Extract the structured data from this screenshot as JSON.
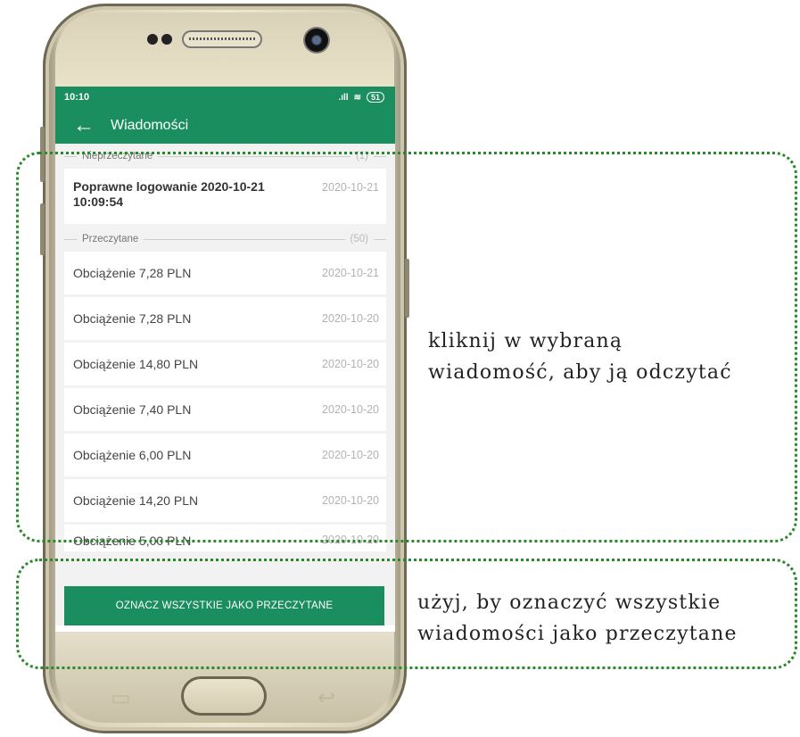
{
  "status_bar": {
    "time": "10:10",
    "signal": ".ıll",
    "wifi": "≋",
    "battery": "51"
  },
  "app_bar": {
    "back_icon": "arrow-left-icon",
    "back_glyph": "←",
    "title": "Wiadomości"
  },
  "sections": {
    "unread": {
      "label": "Nieprzeczytane",
      "count": "(1)"
    },
    "read": {
      "label": "Przeczytane",
      "count": "(50)"
    }
  },
  "unread_messages": [
    {
      "title": "Poprawne logowanie 2020-10-21 10:09:54",
      "date": "2020-10-21"
    }
  ],
  "read_messages": [
    {
      "title": "Obciążenie 7,28 PLN",
      "date": "2020-10-21"
    },
    {
      "title": "Obciążenie 7,28 PLN",
      "date": "2020-10-20"
    },
    {
      "title": "Obciążenie 14,80 PLN",
      "date": "2020-10-20"
    },
    {
      "title": "Obciążenie 7,40 PLN",
      "date": "2020-10-20"
    },
    {
      "title": "Obciążenie 6,00 PLN",
      "date": "2020-10-20"
    },
    {
      "title": "Obciążenie 14,20 PLN",
      "date": "2020-10-20"
    },
    {
      "title": "Obciążenie 5,00 PLN",
      "date": "2020-10-20"
    }
  ],
  "mark_all_button": "OZNACZ WSZYSTKIE JAKO PRZECZYTANE",
  "annotations": {
    "list_hint": "kliknij w wybraną wiadomość, aby ją odczytać",
    "list_hint_line1": "kliknij w wybraną",
    "list_hint_line2": "wiadomość, aby ją odczytać",
    "button_hint_line1": "użyj, by oznaczyć wszystkie",
    "button_hint_line2": "wiadomości jako przeczytane"
  },
  "colors": {
    "brand_green": "#1b8e5f",
    "callout_green": "#2a8a2a"
  }
}
